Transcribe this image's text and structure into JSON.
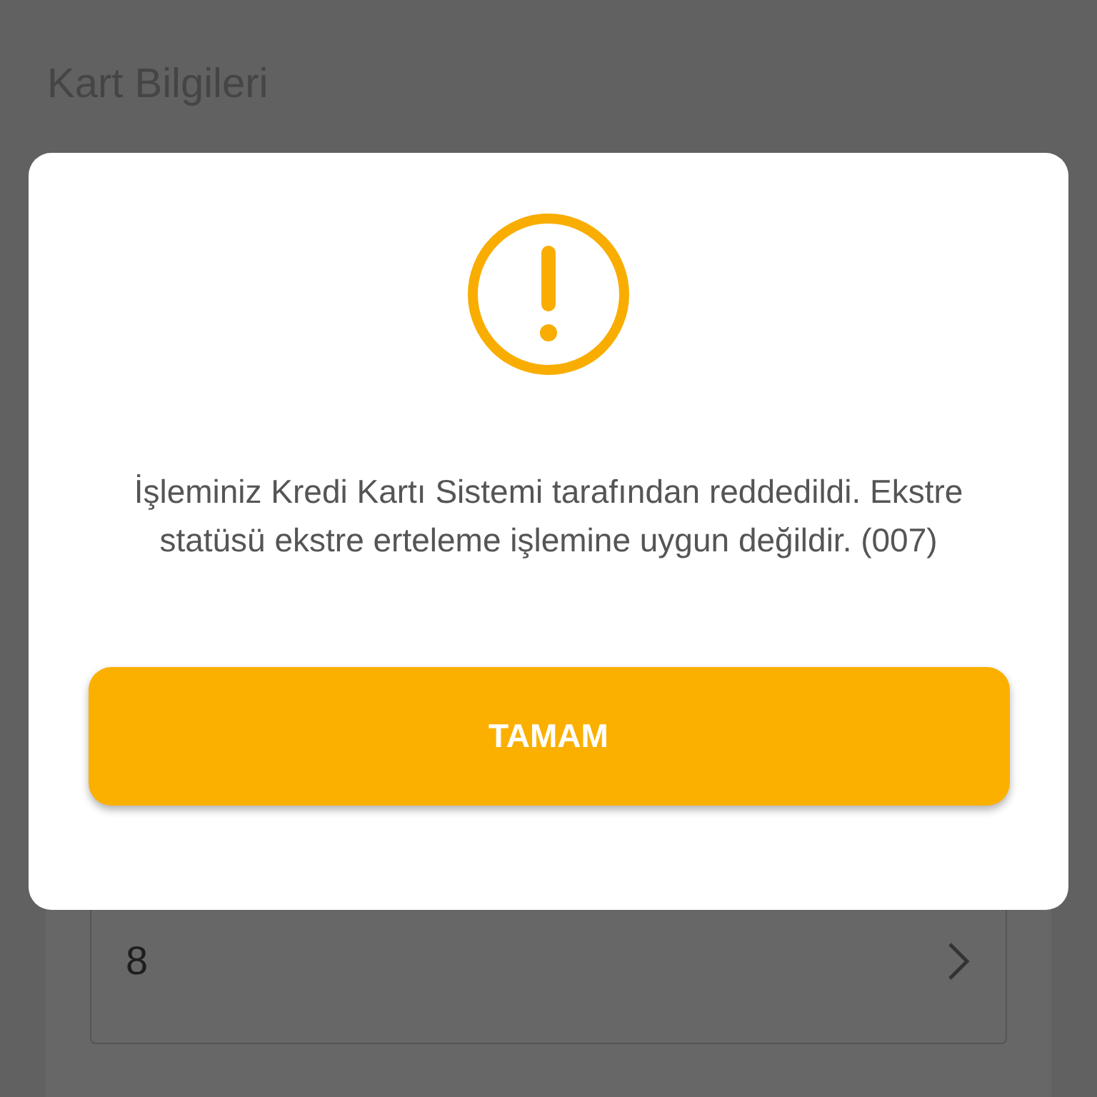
{
  "page": {
    "title": "Kart Bilgileri"
  },
  "field": {
    "value": "8"
  },
  "dialog": {
    "message": "İşleminiz Kredi Kartı Sistemi tarafından reddedildi. Ekstre statüsü ekstre erteleme işlemine uygun değildir. (007)",
    "button": "TAMAM"
  }
}
